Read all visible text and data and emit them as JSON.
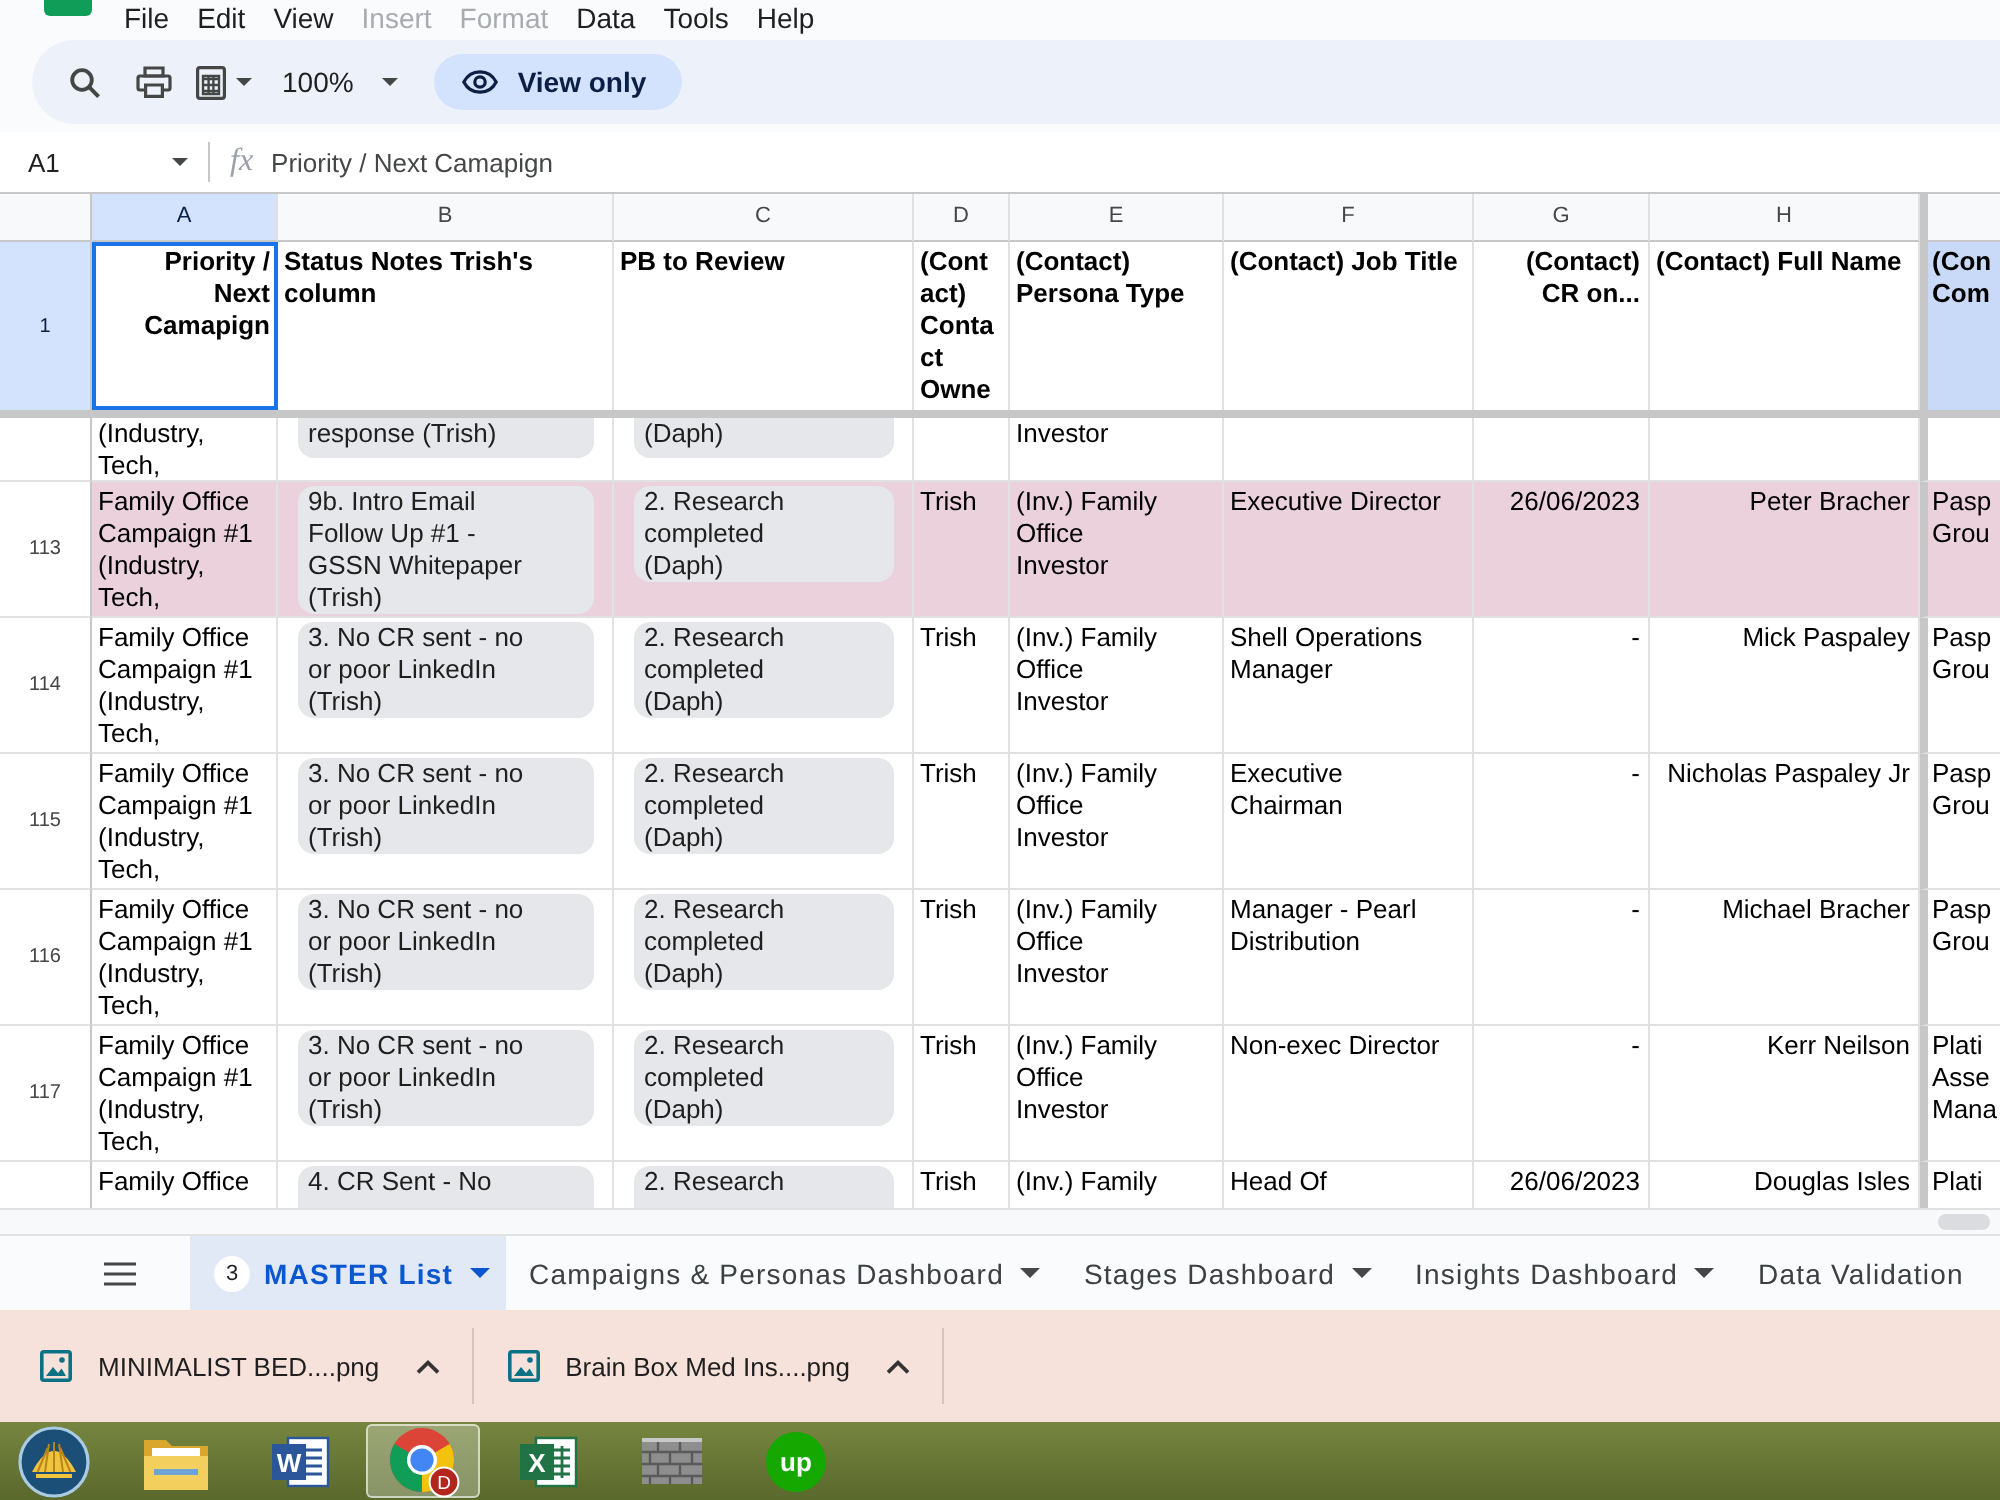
{
  "menu": [
    {
      "label": "File",
      "disabled": false
    },
    {
      "label": "Edit",
      "disabled": false
    },
    {
      "label": "View",
      "disabled": false
    },
    {
      "label": "Insert",
      "disabled": true
    },
    {
      "label": "Format",
      "disabled": true
    },
    {
      "label": "Data",
      "disabled": false
    },
    {
      "label": "Tools",
      "disabled": false
    },
    {
      "label": "Help",
      "disabled": false
    }
  ],
  "toolbar": {
    "zoom": "100%",
    "mode": "View only"
  },
  "formula_bar": {
    "cell_ref": "A1",
    "fx": "fx",
    "formula": "Priority / Next Camapign"
  },
  "sheet": {
    "columns": [
      {
        "letter": "A",
        "selected": true,
        "kind": "text"
      },
      {
        "letter": "B",
        "selected": false,
        "kind": "chip"
      },
      {
        "letter": "C",
        "selected": false,
        "kind": "chip"
      },
      {
        "letter": "D",
        "selected": false,
        "kind": "text"
      },
      {
        "letter": "E",
        "selected": false,
        "kind": "text"
      },
      {
        "letter": "F",
        "selected": false,
        "kind": "text"
      },
      {
        "letter": "G",
        "selected": false,
        "kind": "text"
      },
      {
        "letter": "H",
        "selected": false,
        "kind": "text"
      },
      {
        "selected": false,
        "kind": "text"
      }
    ],
    "header_row": {
      "number": "1",
      "selected": true,
      "cells": [
        {
          "text": "Priority / Next Camapign",
          "selected": true,
          "color": "#ffffff"
        },
        {
          "text": "Status Notes Trish's column",
          "selected": false,
          "color": "#ffffff"
        },
        {
          "text": "PB to Review",
          "selected": false,
          "color": "#ffffff"
        },
        {
          "text": "(Contact) Contact Owne",
          "selected": false,
          "color": "#ffffff"
        },
        {
          "text": "(Contact) Persona Type",
          "selected": false,
          "color": "#ffffff"
        },
        {
          "text": "(Contact) Job Title",
          "selected": false,
          "color": "#ffffff"
        },
        {
          "text": "(Contact) CR on...",
          "selected": false,
          "color": "#ffffff"
        },
        {
          "text": "(Contact) Full Name",
          "selected": false,
          "color": "#ffffff"
        },
        {
          "text": "(Con Com",
          "selected": false,
          "color": "#c9daf8"
        }
      ]
    },
    "rows": [
      {
        "kind": "cut_top",
        "color": "#ffffff",
        "cells": [
          "(Industry, Tech,",
          "response (Trish)",
          "(Daph)",
          null,
          "Investor",
          null,
          null,
          null,
          null
        ]
      },
      {
        "kind": "full",
        "number": "113",
        "color": "#ead1dc",
        "cells": [
          "Family Office Campaign #1 (Industry, Tech,",
          "9b. Intro Email Follow Up #1 - GSSN Whitepaper (Trish)",
          "2. Research completed (Daph)",
          "Trish",
          "(Inv.) Family Office Investor",
          "Executive Director",
          "26/06/2023",
          "Peter Bracher",
          "Pasp Grou"
        ]
      },
      {
        "kind": "full",
        "number": "114",
        "color": "#ffffff",
        "cells": [
          "Family Office Campaign #1 (Industry, Tech,",
          "3. No CR sent - no or poor LinkedIn (Trish)",
          "2. Research completed (Daph)",
          "Trish",
          "(Inv.) Family Office Investor",
          "Shell Operations Manager",
          "-",
          "Mick Paspaley",
          "Pasp Grou"
        ]
      },
      {
        "kind": "full",
        "number": "115",
        "color": "#ffffff",
        "cells": [
          "Family Office Campaign #1 (Industry, Tech,",
          "3. No CR sent - no or poor LinkedIn (Trish)",
          "2. Research completed (Daph)",
          "Trish",
          "(Inv.) Family Office Investor",
          "Executive Chairman",
          "-",
          "Nicholas Paspaley Jr",
          "Pasp Grou"
        ]
      },
      {
        "kind": "full",
        "number": "116",
        "color": "#ffffff",
        "cells": [
          "Family Office Campaign #1 (Industry, Tech,",
          "3. No CR sent - no or poor LinkedIn (Trish)",
          "2. Research completed (Daph)",
          "Trish",
          "(Inv.) Family Office Investor",
          "Manager - Pearl Distribution",
          "-",
          "Michael Bracher",
          "Pasp Grou"
        ]
      },
      {
        "kind": "full",
        "number": "117",
        "color": "#ffffff",
        "cells": [
          "Family Office Campaign #1 (Industry, Tech,",
          "3. No CR sent - no or poor LinkedIn (Trish)",
          "2. Research completed (Daph)",
          "Trish",
          "(Inv.) Family Office Investor",
          "Non-exec Director",
          "-",
          "Kerr Neilson",
          "Plati Asse Mana"
        ]
      },
      {
        "kind": "cut_bottom",
        "color": "#ffffff",
        "cells": [
          "Family Office",
          "4. CR Sent - No",
          "2. Research",
          "Trish",
          "(Inv.) Family",
          "Head Of",
          "26/06/2023",
          "Douglas Isles",
          "Plati"
        ]
      }
    ]
  },
  "sheet_tabs": [
    {
      "label": "MASTER List",
      "badge": "3",
      "selected": true,
      "caret": true
    },
    {
      "label": "Campaigns & Personas Dashboard",
      "selected": false,
      "caret": true
    },
    {
      "label": "Stages Dashboard",
      "selected": false,
      "caret": true
    },
    {
      "label": "Insights Dashboard",
      "selected": false,
      "caret": true
    },
    {
      "label": "Data Validation",
      "selected": false,
      "caret": false
    }
  ],
  "downloads": [
    {
      "file": "MINIMALIST BED....png"
    },
    {
      "file": "Brain Box Med Ins....png"
    }
  ],
  "taskbar": [
    {
      "kind": "start",
      "selected": false
    },
    {
      "kind": "folder",
      "selected": false
    },
    {
      "kind": "word",
      "glyph": "W",
      "selected": false
    },
    {
      "kind": "chrome",
      "badge": "D",
      "selected": true
    },
    {
      "kind": "excel",
      "glyph": "X",
      "selected": false
    },
    {
      "kind": "bricks",
      "selected": false
    },
    {
      "kind": "upwork",
      "glyph": "up",
      "selected": false
    }
  ]
}
